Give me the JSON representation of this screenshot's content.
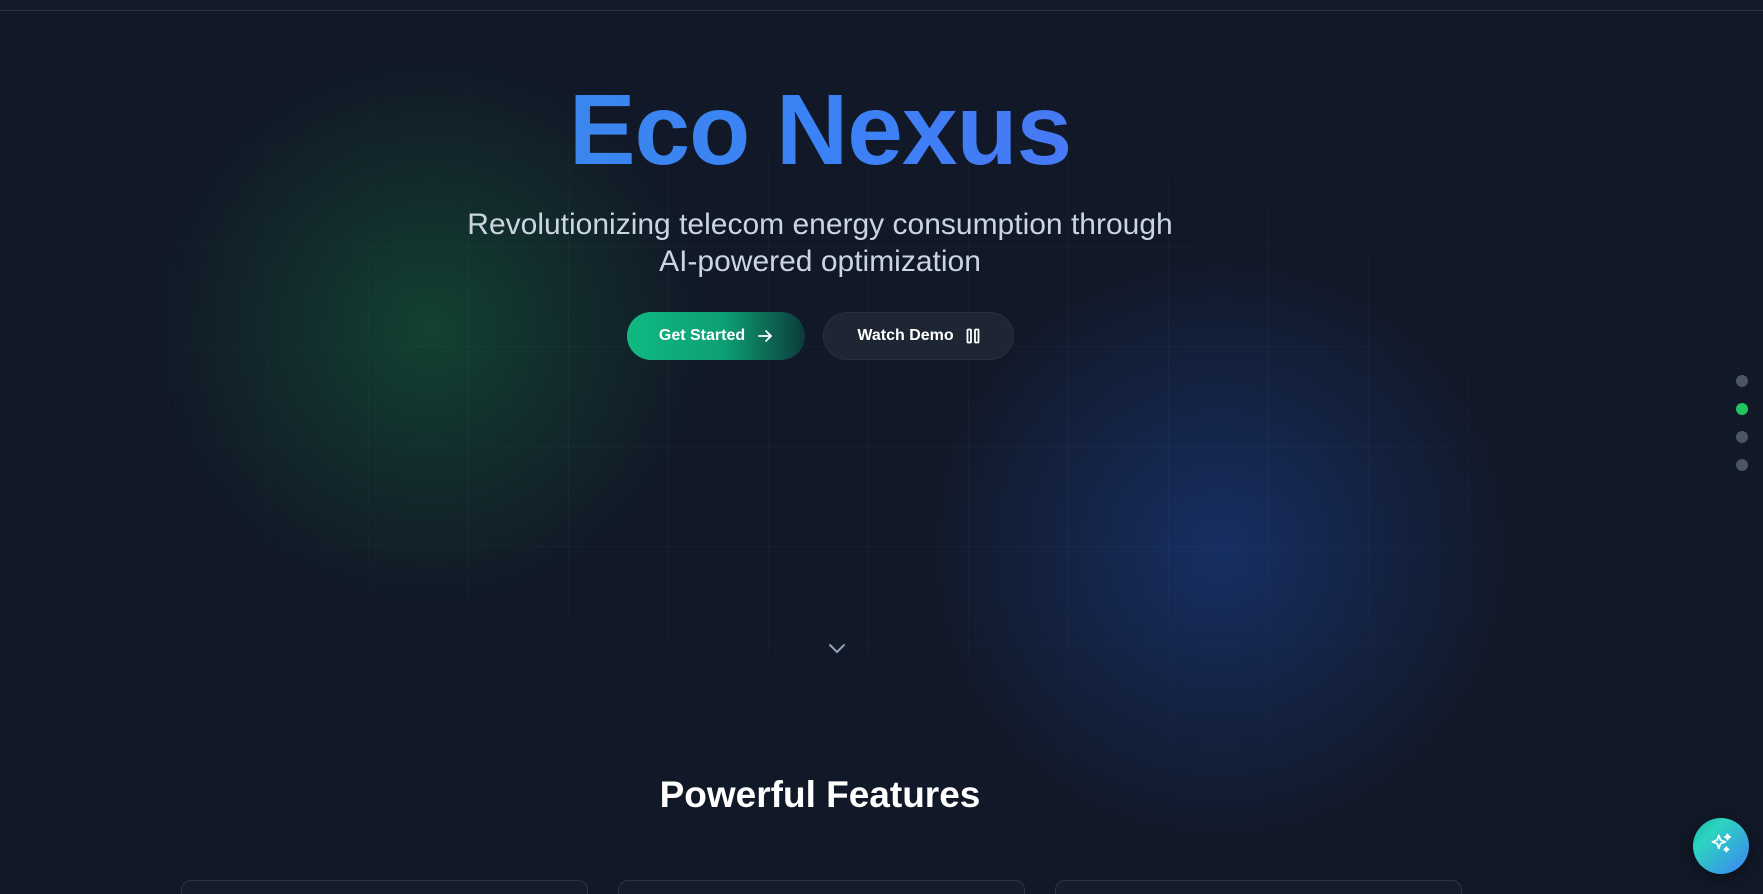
{
  "hero": {
    "title": "Eco Nexus",
    "subtitle_line1": "Revolutionizing telecom energy consumption through",
    "subtitle_line2": "AI-powered optimization",
    "primary_button": {
      "label": "Get Started",
      "icon": "arrow-right-icon"
    },
    "secondary_button": {
      "label": "Watch Demo",
      "icon": "pause-icon"
    },
    "scroll_icon": "chevron-down-icon"
  },
  "section_nav": {
    "count": 4,
    "active_index": 1,
    "active_color": "#22c55e",
    "inactive_color": "#4b5563"
  },
  "features": {
    "title": "Powerful Features"
  },
  "fab": {
    "icon": "sparkles-icon"
  },
  "colors": {
    "background": "#111827",
    "title_gradient_start": "#3b8fdc",
    "title_gradient_end": "#6366f1",
    "primary_button_start": "#10b981",
    "glow_green": "#16a34a",
    "glow_blue": "#2563eb"
  }
}
